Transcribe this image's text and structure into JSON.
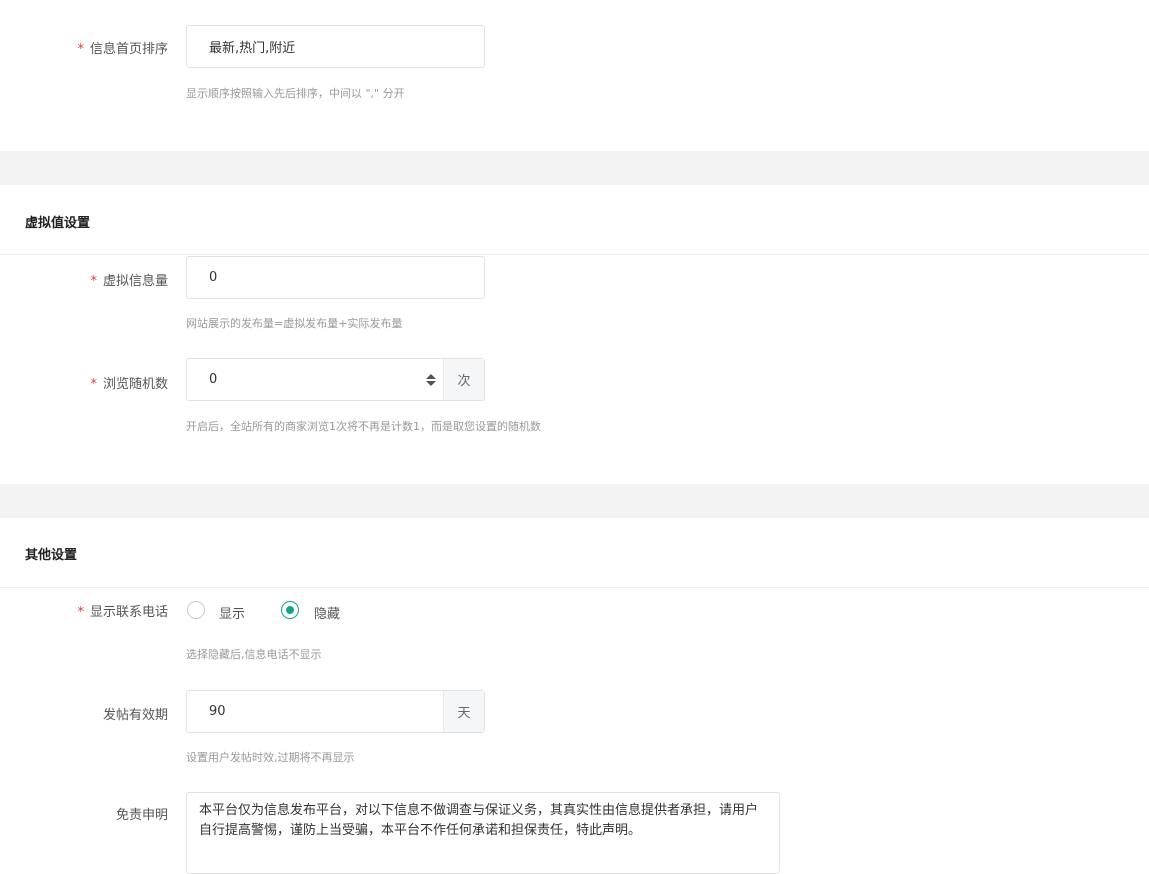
{
  "sort": {
    "label": "信息首页排序",
    "value": "最新,热门,附近",
    "hint": "显示顺序按照输入先后排序，中间以 \",\" 分开"
  },
  "virtual": {
    "title": "虚拟值设置",
    "count": {
      "label": "虚拟信息量",
      "value": "0",
      "hint": "网站展示的发布量=虚拟发布量+实际发布量"
    },
    "browse": {
      "label": "浏览随机数",
      "value": "0",
      "unit": "次",
      "hint": "开启后，全站所有的商家浏览1次将不再是计数1，而是取您设置的随机数"
    }
  },
  "other": {
    "title": "其他设置",
    "phone": {
      "label": "显示联系电话",
      "option_show": "显示",
      "option_hide": "隐藏",
      "selected": "隐藏",
      "hint": "选择隐藏后,信息电话不显示"
    },
    "validity": {
      "label": "发帖有效期",
      "value": "90",
      "unit": "天",
      "hint": "设置用户发帖时效,过期将不再显示"
    },
    "disclaimer": {
      "label": "免责申明",
      "value": "本平台仅为信息发布平台，对以下信息不做调查与保证义务，其真实性由信息提供者承担，请用户自行提高警惕，谨防上当受骗，本平台不作任何承诺和担保责任，特此声明。"
    }
  },
  "colors": {
    "required": "#e4393c",
    "accent": "#13a58c",
    "section_band": "#f3f3f3"
  },
  "icons": {
    "required_mark": "*",
    "spinner": "up-down-arrows"
  }
}
